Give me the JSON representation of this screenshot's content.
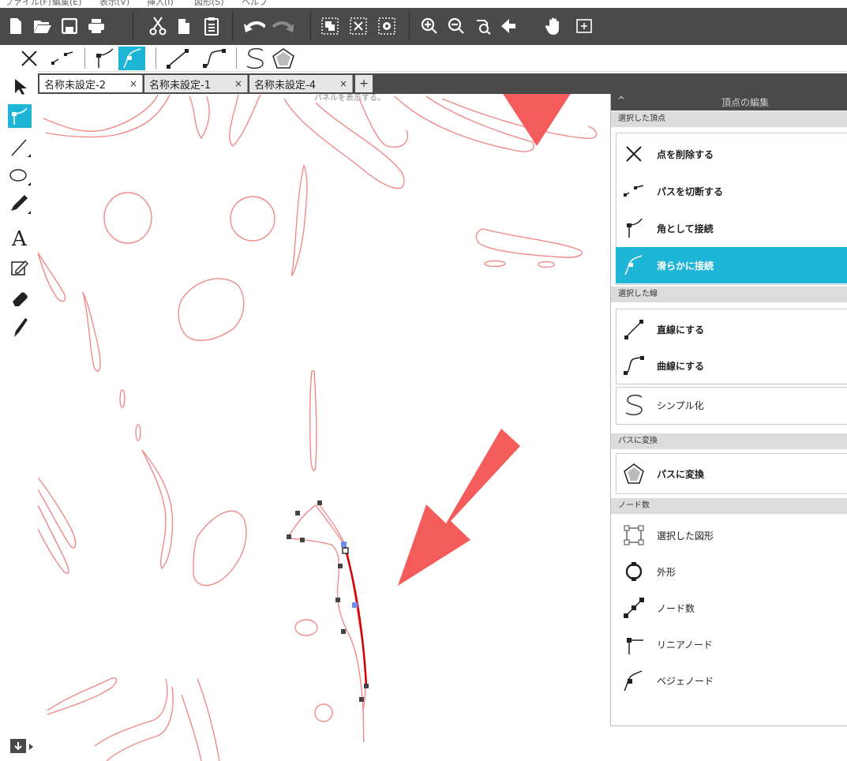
{
  "menubar": {
    "items": [
      "ファイル(F)",
      "編集(E)",
      "表示(V)",
      "挿入(I)",
      "図形(S)",
      "ヘルプ"
    ]
  },
  "toolbar": {
    "icons": [
      "new-document-icon",
      "open-folder-icon",
      "save-icon",
      "print-icon",
      "cut-icon",
      "copy-icon",
      "paste-icon",
      "undo-icon",
      "redo-icon",
      "group-icon",
      "ungroup-icon",
      "settings-icon",
      "zoom-in-icon",
      "zoom-out-icon",
      "zoom-fit-icon",
      "move-icon",
      "hand-icon",
      "fit-page-icon"
    ]
  },
  "edit_toolbar": {
    "hint": "パネルを表示する。"
  },
  "tabs": [
    {
      "label": "名称未設定-2",
      "close": "×"
    },
    {
      "label": "名称未設定-1",
      "close": "×"
    },
    {
      "label": "名称未設定-4",
      "close": "×"
    }
  ],
  "tab_add": "+",
  "panel": {
    "title": "頂点の編集",
    "collapse": "^",
    "sections": {
      "selected_point": "選択した頂点",
      "selected_line": "選択した線",
      "convert_path": "パスに変換",
      "node_count": "ノード数"
    },
    "items": {
      "delete_point": "点を削除する",
      "cut_path": "パスを切断する",
      "corner_join": "角として接続",
      "smooth_join": "滑らかに接続",
      "make_straight": "直線にする",
      "make_curve": "曲線にする",
      "simplify": "シンプル化",
      "to_path": "パスに変換",
      "selected_shape": "選択した図形",
      "outline": "外形",
      "node_count": "ノード数",
      "linear_node": "リニアノード",
      "bezier_node": "ベジェノード"
    }
  },
  "colors": {
    "accent": "#1fb5d6",
    "arrow": "#f45b5b",
    "cut_line": "#f08a8a",
    "selected_path": "#d40000",
    "dark_ui": "#4a4a4a"
  }
}
